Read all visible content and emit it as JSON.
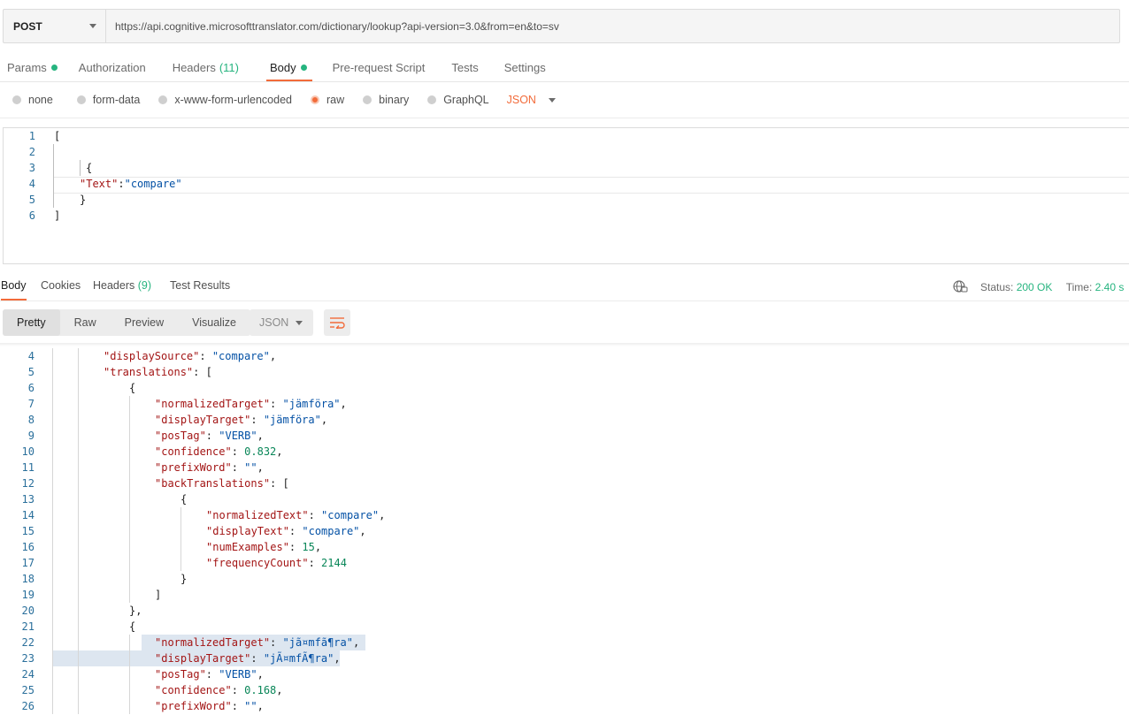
{
  "request": {
    "method": "POST",
    "url": "https://api.cognitive.microsofttranslator.com/dictionary/lookup?api-version=3.0&from=en&to=sv"
  },
  "request_tabs": {
    "params": "Params",
    "authorization": "Authorization",
    "headers": "Headers",
    "headers_count": "(11)",
    "body": "Body",
    "prerequest": "Pre-request Script",
    "tests": "Tests",
    "settings": "Settings"
  },
  "body_types": {
    "none": "none",
    "form_data": "form-data",
    "urlencoded": "x-www-form-urlencoded",
    "raw": "raw",
    "binary": "binary",
    "graphql": "GraphQL",
    "format": "JSON"
  },
  "request_editor": {
    "lines": [
      "1",
      "2",
      "3",
      "4",
      "5",
      "6"
    ],
    "open_bracket": "[",
    "open_brace": "{",
    "key": "\"Text\"",
    "colon": ":",
    "value": "\"compare\"",
    "close_brace": "}",
    "close_bracket": "]"
  },
  "response_tabs": {
    "body": "Body",
    "cookies": "Cookies",
    "headers": "Headers",
    "headers_count": "(9)",
    "test_results": "Test Results"
  },
  "response_status": {
    "status_label": "Status:",
    "status_value": "200 OK",
    "time_label": "Time:",
    "time_value": "2.40 s"
  },
  "view_modes": {
    "pretty": "Pretty",
    "raw": "Raw",
    "preview": "Preview",
    "visualize": "Visualize",
    "format": "JSON"
  },
  "response_lines": [
    {
      "n": "4",
      "indent": 2,
      "parts": [
        [
          "key",
          "\"displaySource\""
        ],
        [
          "p",
          ": "
        ],
        [
          "str",
          "\"compare\""
        ],
        [
          "p",
          ","
        ]
      ]
    },
    {
      "n": "5",
      "indent": 2,
      "parts": [
        [
          "key",
          "\"translations\""
        ],
        [
          "p",
          ": ["
        ]
      ]
    },
    {
      "n": "6",
      "indent": 3,
      "parts": [
        [
          "p",
          "{"
        ]
      ]
    },
    {
      "n": "7",
      "indent": 4,
      "parts": [
        [
          "key",
          "\"normalizedTarget\""
        ],
        [
          "p",
          ": "
        ],
        [
          "str",
          "\"jämföra\""
        ],
        [
          "p",
          ","
        ]
      ]
    },
    {
      "n": "8",
      "indent": 4,
      "parts": [
        [
          "key",
          "\"displayTarget\""
        ],
        [
          "p",
          ": "
        ],
        [
          "str",
          "\"jämföra\""
        ],
        [
          "p",
          ","
        ]
      ]
    },
    {
      "n": "9",
      "indent": 4,
      "parts": [
        [
          "key",
          "\"posTag\""
        ],
        [
          "p",
          ": "
        ],
        [
          "str",
          "\"VERB\""
        ],
        [
          "p",
          ","
        ]
      ]
    },
    {
      "n": "10",
      "indent": 4,
      "parts": [
        [
          "key",
          "\"confidence\""
        ],
        [
          "p",
          ": "
        ],
        [
          "num",
          "0.832"
        ],
        [
          "p",
          ","
        ]
      ]
    },
    {
      "n": "11",
      "indent": 4,
      "parts": [
        [
          "key",
          "\"prefixWord\""
        ],
        [
          "p",
          ": "
        ],
        [
          "str",
          "\"\""
        ],
        [
          "p",
          ","
        ]
      ]
    },
    {
      "n": "12",
      "indent": 4,
      "parts": [
        [
          "key",
          "\"backTranslations\""
        ],
        [
          "p",
          ": ["
        ]
      ]
    },
    {
      "n": "13",
      "indent": 5,
      "parts": [
        [
          "p",
          "{"
        ]
      ]
    },
    {
      "n": "14",
      "indent": 6,
      "parts": [
        [
          "key",
          "\"normalizedText\""
        ],
        [
          "p",
          ": "
        ],
        [
          "str",
          "\"compare\""
        ],
        [
          "p",
          ","
        ]
      ]
    },
    {
      "n": "15",
      "indent": 6,
      "parts": [
        [
          "key",
          "\"displayText\""
        ],
        [
          "p",
          ": "
        ],
        [
          "str",
          "\"compare\""
        ],
        [
          "p",
          ","
        ]
      ]
    },
    {
      "n": "16",
      "indent": 6,
      "parts": [
        [
          "key",
          "\"numExamples\""
        ],
        [
          "p",
          ": "
        ],
        [
          "num",
          "15"
        ],
        [
          "p",
          ","
        ]
      ]
    },
    {
      "n": "17",
      "indent": 6,
      "parts": [
        [
          "key",
          "\"frequencyCount\""
        ],
        [
          "p",
          ": "
        ],
        [
          "num",
          "2144"
        ]
      ]
    },
    {
      "n": "18",
      "indent": 5,
      "parts": [
        [
          "p",
          "}"
        ]
      ]
    },
    {
      "n": "19",
      "indent": 4,
      "parts": [
        [
          "p",
          "]"
        ]
      ]
    },
    {
      "n": "20",
      "indent": 3,
      "parts": [
        [
          "p",
          "},"
        ]
      ]
    },
    {
      "n": "21",
      "indent": 3,
      "parts": [
        [
          "p",
          "{"
        ]
      ]
    },
    {
      "n": "22",
      "indent": 4,
      "parts": [
        [
          "key",
          "\"normalizedTarget\""
        ],
        [
          "p",
          ": "
        ],
        [
          "str",
          "\"jã¤mfã¶ra\""
        ],
        [
          "p",
          ","
        ]
      ]
    },
    {
      "n": "23",
      "indent": 4,
      "parts": [
        [
          "key",
          "\"displayTarget\""
        ],
        [
          "p",
          ": "
        ],
        [
          "str",
          "\"jÃ¤mfÃ¶ra\""
        ],
        [
          "p",
          ","
        ]
      ]
    },
    {
      "n": "24",
      "indent": 4,
      "parts": [
        [
          "key",
          "\"posTag\""
        ],
        [
          "p",
          ": "
        ],
        [
          "str",
          "\"VERB\""
        ],
        [
          "p",
          ","
        ]
      ]
    },
    {
      "n": "25",
      "indent": 4,
      "parts": [
        [
          "key",
          "\"confidence\""
        ],
        [
          "p",
          ": "
        ],
        [
          "num",
          "0.168"
        ],
        [
          "p",
          ","
        ]
      ]
    },
    {
      "n": "26",
      "indent": 4,
      "parts": [
        [
          "key",
          "\"prefixWord\""
        ],
        [
          "p",
          ": "
        ],
        [
          "str",
          "\"\""
        ],
        [
          "p",
          ","
        ]
      ]
    }
  ],
  "colors": {
    "accent": "#f26b3a",
    "success": "#26b47f",
    "json_key": "#a31515",
    "json_string": "#0451a5",
    "json_number": "#098658"
  }
}
